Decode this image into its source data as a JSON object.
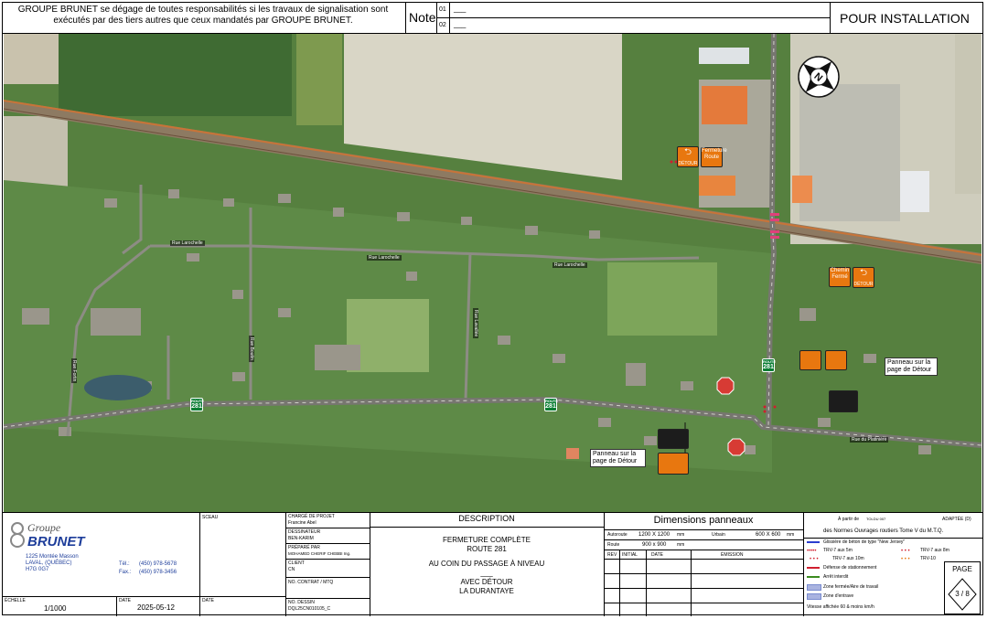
{
  "header": {
    "disclaimer": "GROUPE BRUNET se dégage de toutes responsabilités si les travaux de signalisation sont exécutés par des tiers autres que ceux mandatés par GROUPE BRUNET.",
    "note_label": "Note",
    "note_rows": [
      {
        "num": "01",
        "text": "___"
      },
      {
        "num": "02",
        "text": "___"
      }
    ],
    "status": "POUR INSTALLATION"
  },
  "map": {
    "streets": [
      "Rue Larochelle",
      "Rue Larochelle",
      "Rue Larochelle",
      "Rue Boutin",
      "Rue Lavallée",
      "Rue Fortin",
      "Rue du Platinière"
    ],
    "route_shields": [
      {
        "number": "281",
        "sub": "ROUTE"
      },
      {
        "number": "281",
        "sub": "ROUTE"
      },
      {
        "number": "281",
        "sub": "ROUTE"
      }
    ],
    "callouts": [
      "Panneau sur la page de Détour",
      "Panneau sur la page de Détour"
    ],
    "stop_text": "ARRÊT",
    "detour_texts": [
      "DÉTOUR",
      "Fermeture Route",
      "Chemin Fermé",
      "DÉTOUR"
    ]
  },
  "title_block": {
    "logo_line1": "Groupe",
    "logo_line2": "BRUNET",
    "address": [
      "1225 Montée Masson",
      "LAVAL, (QUÉBEC)",
      "H7G 0G7"
    ],
    "tel_label": "Tél.:",
    "tel": "(450) 978-5678",
    "fax_label": "Fax.:",
    "fax": "(450) 978-3456",
    "sceau_label": "SCEAU",
    "charge_label": "CHARGÉ DE PROJET",
    "charge": "Francine Abel",
    "dessinateur_label": "DESSINATEUR",
    "dessinateur": "BEN-KARIM",
    "prepare_label": "PRÉPARÉ PAR",
    "prepare": "MOHAMED CHERIF CHEBBI Ing.",
    "client_label": "CLIENT",
    "client": "CN",
    "contrat_label": "NO. CONTRAT / MTQ",
    "contrat": "",
    "dessin_label": "NO. DESSIN",
    "dessin": "DQL25CN010105_C",
    "echelle_label": "ÉCHELLE",
    "echelle": "1/1000",
    "date_label": "DATE",
    "date": "2025-05-12",
    "date2_label": "DATE",
    "description_label": "DESCRIPTION",
    "description_lines": [
      "FERMETURE COMPLÈTE",
      "ROUTE 281",
      "AU COIN DU PASSAGE À NIVEAU",
      "___",
      "AVEC DÉTOUR",
      "LA DURANTAYE"
    ],
    "dims_title": "Dimensions panneaux",
    "dims": [
      {
        "label": "Autoroute",
        "value": "1200 X 1200",
        "unit": "mm",
        "label2": "Urbain",
        "value2": "600 X 600",
        "unit2": "mm"
      },
      {
        "label": "Route",
        "value": "900 x 900",
        "unit": "mm"
      }
    ],
    "rev_headers": [
      "REV",
      "INITIAL",
      "DATE",
      "ÉMISSION"
    ],
    "norm_apartir": "À partir de",
    "norm_tome": "TOLDU 007",
    "norm_adaptee": "ADAPTÉE (D)",
    "norm_text": "des Normes Ouvrages routiers Tome V du M.T.Q.",
    "legend": [
      {
        "text": "Glissière de béton de type \"New Jersey\"",
        "color": "#2b3ecf"
      },
      {
        "text": "TRV-7 aux 5m",
        "color": "#d01f2f"
      },
      {
        "text": "TRV-7 aux 8m",
        "color": "#d01f2f"
      },
      {
        "text": "TRV-7 aux 10m",
        "color": "#d01f2f"
      },
      {
        "text": "TRV-10",
        "color": "#e8770f"
      },
      {
        "text": "Défense de stationnement",
        "color": "#d01f2f"
      },
      {
        "text": "Arrêt interdit",
        "color": "#3b8b1f"
      },
      {
        "text": "Zone fermée/Aire de travail",
        "color": "#7a8ccf"
      },
      {
        "text": "Zone d'entrave",
        "color": "#7a8ccf"
      },
      {
        "text": "Vitesse affichée 60 & moins km/h",
        "color": ""
      }
    ],
    "page_label": "PAGE",
    "page_value": "3 / 8"
  }
}
